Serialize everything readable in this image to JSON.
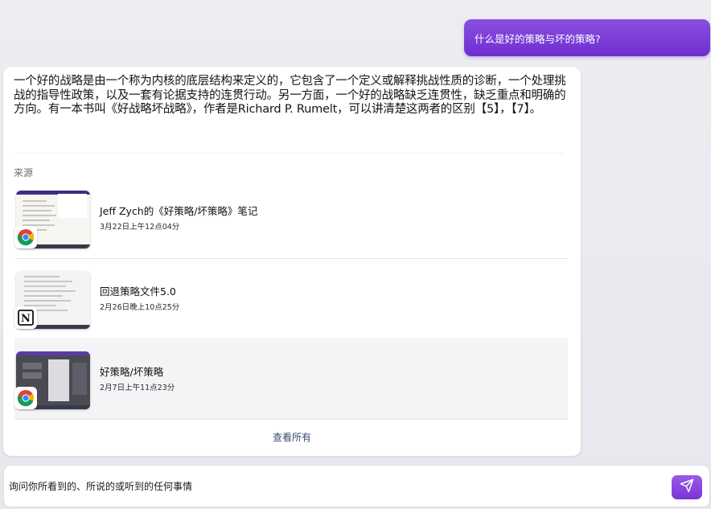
{
  "user_message": "什么是好的策略与坏的策略?",
  "answer": {
    "text": "一个好的战略是由一个称为内核的底层结构来定义的，它包含了一个定义或解释挑战性质的诊断，一个处理挑战的指导性政策，以及一套有论据支持的连贯行动。另一方面，一个好的战略缺乏连贯性，缺乏重点和明确的方向。有一本书叫《好战略坏战略》，作者是Richard P. Rumelt，可以讲清楚这两者的区别【5】，【7】。",
    "sources_label": "来源",
    "sources": [
      {
        "title": "Jeff Zych的《好策略/坏策略》笔记",
        "date": "3月22日上午12点04分",
        "app_icon": "chrome-icon"
      },
      {
        "title": "回退策略文件5.0",
        "date": "2月26日晚上10点25分",
        "app_icon": "notion-icon"
      },
      {
        "title": "好策略/坏策略",
        "date": "2月7日上午11点23分",
        "app_icon": "chrome-icon"
      }
    ],
    "view_all_label": "查看所有"
  },
  "input": {
    "placeholder": "询问你所看到的、所说的或听到的任何事情",
    "value": ""
  },
  "colors": {
    "accent": "#7a35d6",
    "user_bubble": "#8a4fe0",
    "card": "#ffffff",
    "background": "#e9eaef"
  },
  "icons": {
    "send": "send-icon",
    "browser": "chrome-icon",
    "notes": "notion-icon"
  }
}
